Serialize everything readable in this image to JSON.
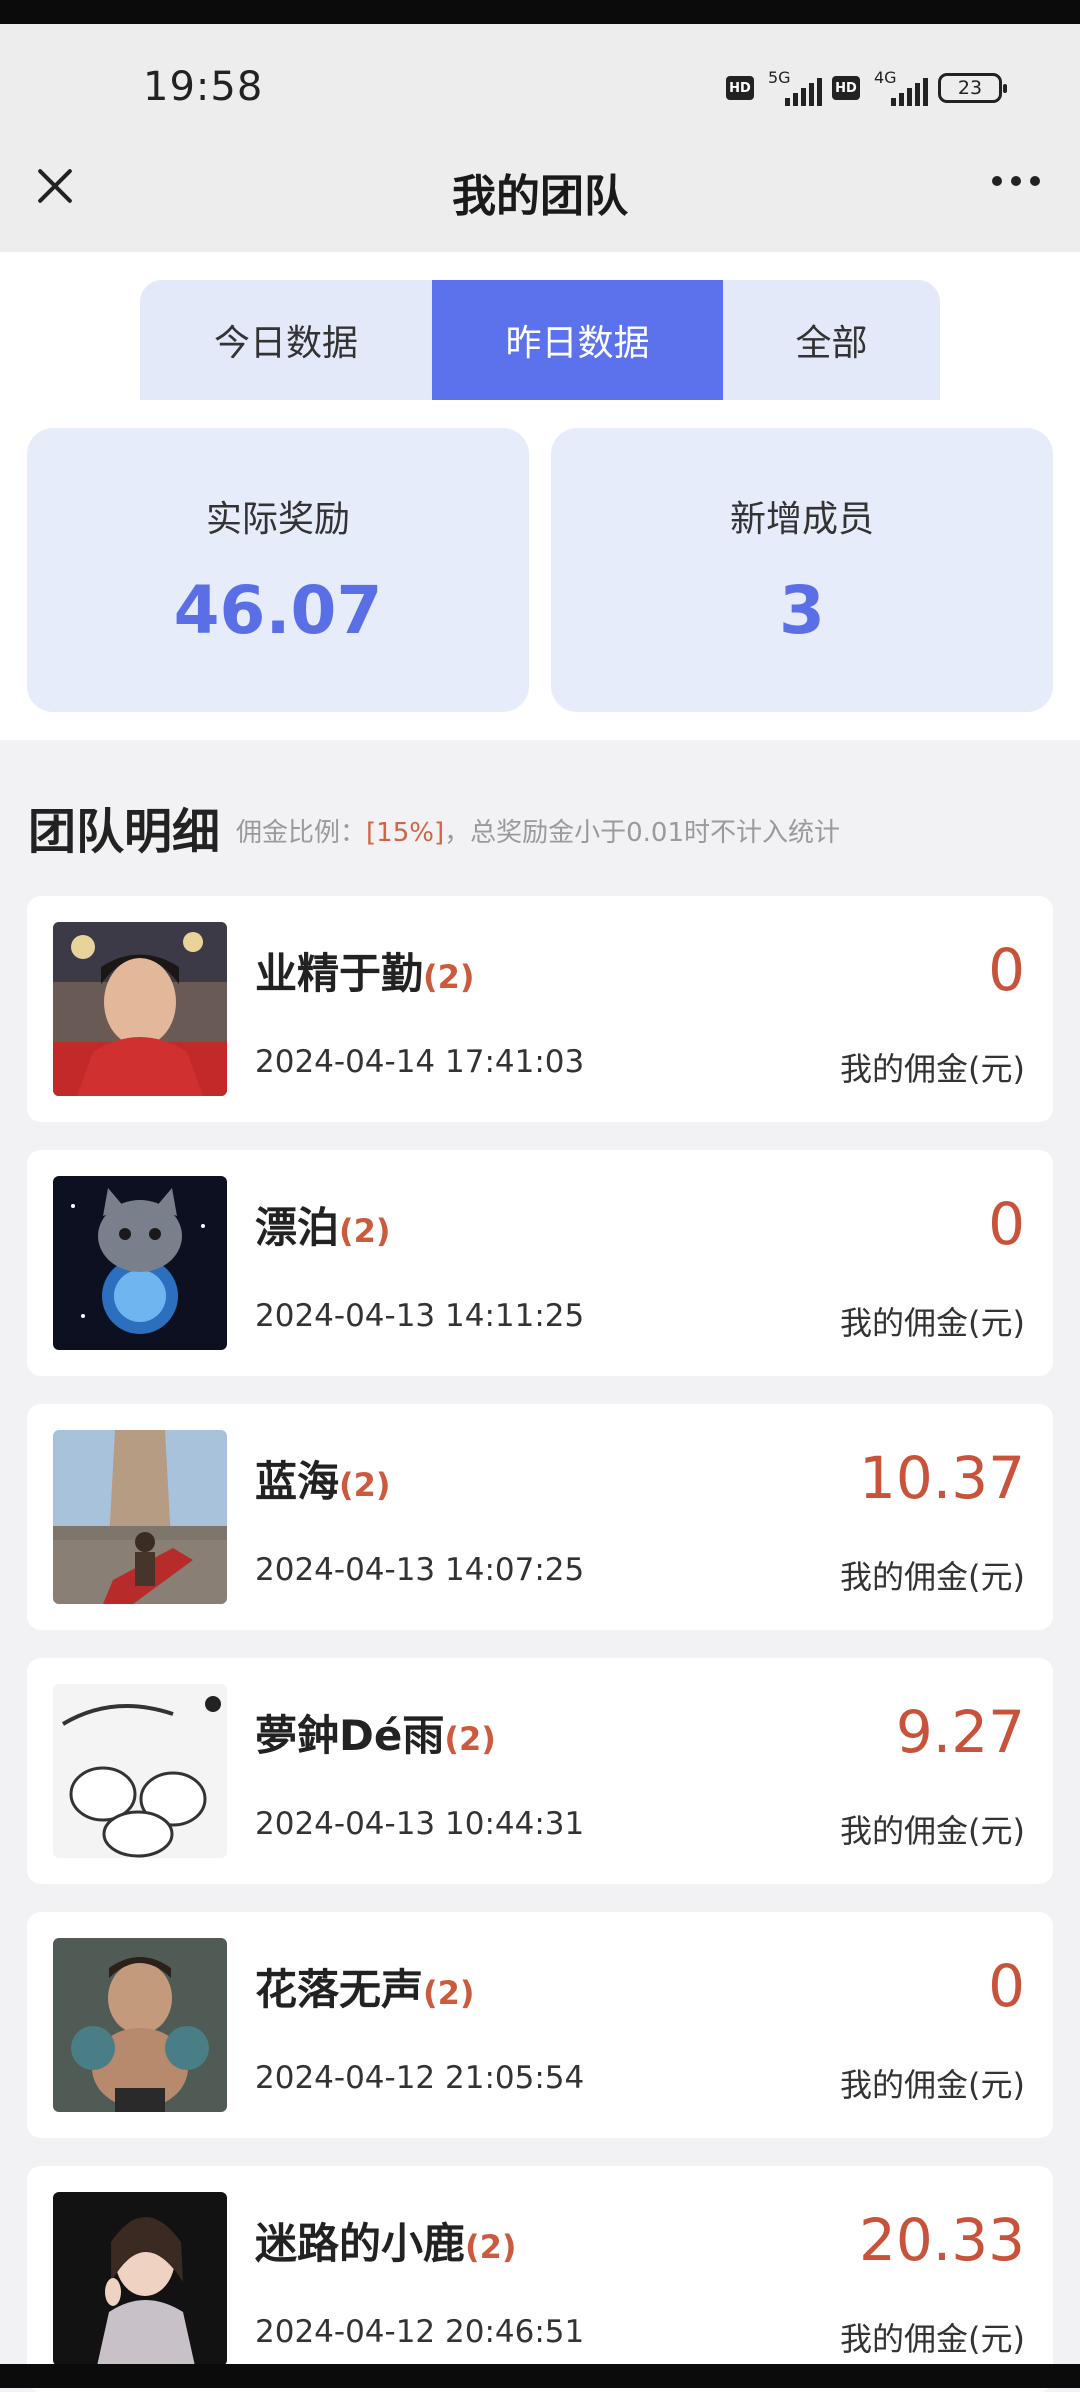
{
  "status": {
    "time": "19:58",
    "net1": "5G",
    "net2": "4G",
    "hd": "HD",
    "battery": "23"
  },
  "header": {
    "title": "我的团队"
  },
  "tabs": [
    {
      "label": "今日数据"
    },
    {
      "label": "昨日数据",
      "active": true
    },
    {
      "label": "全部"
    }
  ],
  "stats": [
    {
      "label": "实际奖励",
      "value": "46.07"
    },
    {
      "label": "新增成员",
      "value": "3"
    }
  ],
  "section": {
    "title": "团队明细",
    "note_prefix": "佣金比例：",
    "note_pct": "[15%]",
    "note_suffix": "，总奖励金小于0.01时不计入统计"
  },
  "members": [
    {
      "name": "业精于勤",
      "level": "(2)",
      "date": "2024-04-14 17:41:03",
      "amount": "0",
      "amount_label": "我的佣金(元)"
    },
    {
      "name": "漂泊",
      "level": "(2)",
      "date": "2024-04-13 14:11:25",
      "amount": "0",
      "amount_label": "我的佣金(元)"
    },
    {
      "name": "蓝海",
      "level": "(2)",
      "date": "2024-04-13 14:07:25",
      "amount": "10.37",
      "amount_label": "我的佣金(元)"
    },
    {
      "name": "夢鈡Dé雨",
      "level": "(2)",
      "date": "2024-04-13 10:44:31",
      "amount": "9.27",
      "amount_label": "我的佣金(元)"
    },
    {
      "name": "花落无声",
      "level": "(2)",
      "date": "2024-04-12 21:05:54",
      "amount": "0",
      "amount_label": "我的佣金(元)"
    },
    {
      "name": "迷路的小鹿",
      "level": "(2)",
      "date": "2024-04-12 20:46:51",
      "amount": "20.33",
      "amount_label": "我的佣金(元)"
    }
  ],
  "colors": {
    "accent": "#5b72ec",
    "amount": "#c8523a",
    "stat_bg": "#e7ecfb"
  }
}
